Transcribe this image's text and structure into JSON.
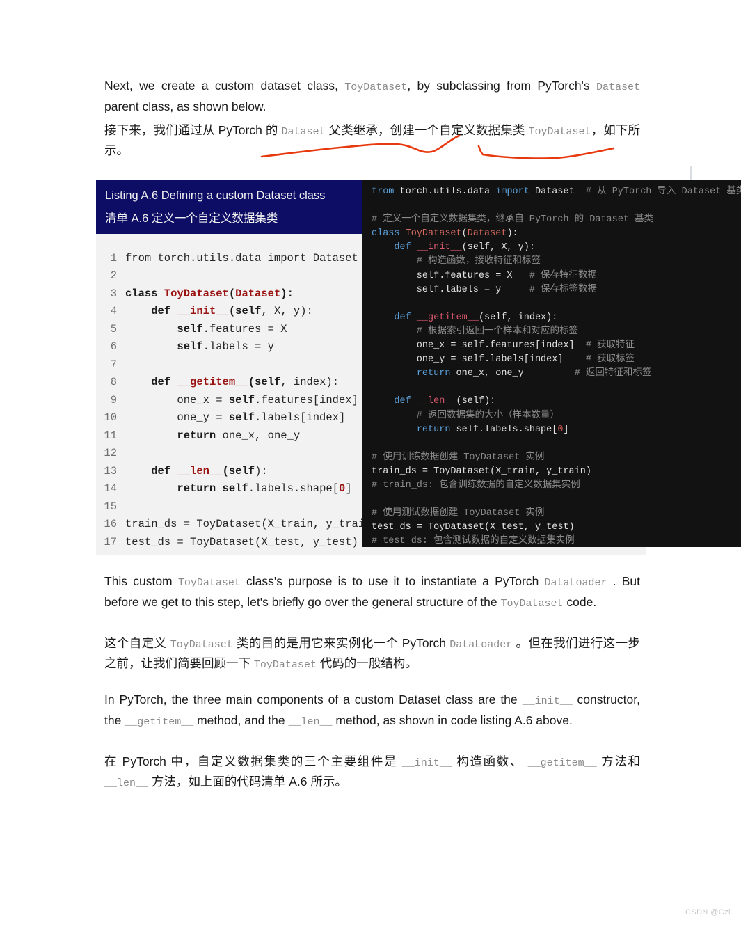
{
  "document": {
    "watermark": "CSDN @Czi."
  },
  "paragraphs": {
    "intro_en_1": "Next, we create a custom dataset class,",
    "intro_en_code1": "ToyDataset",
    "intro_en_2": ", by subclassing from PyTorch's",
    "intro_en_code2": "Dataset",
    "intro_en_3": "parent class, as shown below.",
    "intro_zh_1": "接下来，我们通过从 PyTorch 的",
    "intro_zh_code1": "Dataset",
    "intro_zh_2": "父类继承，创建一个自定义数据集类",
    "intro_zh_code2": "ToyDataset",
    "intro_zh_3": "，如下所示。",
    "mid_en_1": "This custom",
    "mid_en_code1": "ToyDataset",
    "mid_en_2": "class's purpose is to use it to instantiate a PyTorch",
    "mid_en_code2": "DataLoader",
    "mid_en_3": ". But before we get to this step, let's briefly go over the general structure of the",
    "mid_en_code3": "ToyDataset",
    "mid_en_4": "code.",
    "mid_zh_1": "这个自定义",
    "mid_zh_code1": "ToyDataset",
    "mid_zh_2": "类的目的是用它来实例化一个 PyTorch",
    "mid_zh_code2": "DataLoader",
    "mid_zh_3": "。但在我们进行这一步之前，让我们简要回顾一下",
    "mid_zh_code3": "ToyDataset",
    "mid_zh_4": "代码的一般结构。",
    "last_en_1": "In PyTorch, the three main components of a custom Dataset class are the",
    "last_en_code1": "__init__",
    "last_en_2": "constructor, the",
    "last_en_code2": "__getitem__",
    "last_en_3": "method, and the",
    "last_en_code3": "__len__",
    "last_en_4": "method, as shown in code listing A.6 above.",
    "last_zh_1": "在 PyTorch 中，自定义数据集类的三个主要组件是",
    "last_zh_code1": "__init__",
    "last_zh_2": "构造函数、",
    "last_zh_code2": "__getitem__",
    "last_zh_3": "方法和",
    "last_zh_code3": "__len__",
    "last_zh_4": "方法，如上面的代码清单 A.6 所示。"
  },
  "listing": {
    "caption_en": "Listing A.6 Defining a custom Dataset class",
    "caption_zh": "清单 A.6 定义一个自定义数据集类",
    "header_bg": "#0d0d66",
    "code_bg": "#f2f2f2",
    "lines": [
      {
        "n": "1",
        "parts": [
          {
            "t": "from torch.utils.data import Dataset",
            "c": "plain"
          }
        ]
      },
      {
        "n": "2",
        "parts": []
      },
      {
        "n": "3",
        "parts": [
          {
            "t": "class ",
            "c": "kw"
          },
          {
            "t": "ToyDataset",
            "c": "nm"
          },
          {
            "t": "(",
            "c": "kw"
          },
          {
            "t": "Dataset",
            "c": "nm"
          },
          {
            "t": "):",
            "c": "kw"
          }
        ]
      },
      {
        "n": "4",
        "parts": [
          {
            "t": "    ",
            "c": "plain"
          },
          {
            "t": "def ",
            "c": "kw"
          },
          {
            "t": "__init__",
            "c": "nm"
          },
          {
            "t": "(",
            "c": "kw"
          },
          {
            "t": "self",
            "c": "kw"
          },
          {
            "t": ", X, y):",
            "c": "plain"
          }
        ]
      },
      {
        "n": "5",
        "parts": [
          {
            "t": "        ",
            "c": "plain"
          },
          {
            "t": "self",
            "c": "kw"
          },
          {
            "t": ".features = X",
            "c": "plain"
          }
        ]
      },
      {
        "n": "6",
        "parts": [
          {
            "t": "        ",
            "c": "plain"
          },
          {
            "t": "self",
            "c": "kw"
          },
          {
            "t": ".labels = y",
            "c": "plain"
          }
        ]
      },
      {
        "n": "7",
        "parts": []
      },
      {
        "n": "8",
        "parts": [
          {
            "t": "    ",
            "c": "plain"
          },
          {
            "t": "def ",
            "c": "kw"
          },
          {
            "t": "__getitem__",
            "c": "nm"
          },
          {
            "t": "(",
            "c": "kw"
          },
          {
            "t": "self",
            "c": "kw"
          },
          {
            "t": ", index):",
            "c": "plain"
          }
        ]
      },
      {
        "n": "9",
        "parts": [
          {
            "t": "        one_x = ",
            "c": "plain"
          },
          {
            "t": "self",
            "c": "kw"
          },
          {
            "t": ".features[index]",
            "c": "plain"
          }
        ]
      },
      {
        "n": "10",
        "parts": [
          {
            "t": "        one_y = ",
            "c": "plain"
          },
          {
            "t": "self",
            "c": "kw"
          },
          {
            "t": ".labels[index]",
            "c": "plain"
          }
        ]
      },
      {
        "n": "11",
        "parts": [
          {
            "t": "        ",
            "c": "plain"
          },
          {
            "t": "return",
            "c": "kw"
          },
          {
            "t": " one_x, one_y",
            "c": "plain"
          }
        ]
      },
      {
        "n": "12",
        "parts": []
      },
      {
        "n": "13",
        "parts": [
          {
            "t": "    ",
            "c": "plain"
          },
          {
            "t": "def ",
            "c": "kw"
          },
          {
            "t": "__len__",
            "c": "nm"
          },
          {
            "t": "(",
            "c": "kw"
          },
          {
            "t": "self",
            "c": "kw"
          },
          {
            "t": "):",
            "c": "plain"
          }
        ]
      },
      {
        "n": "14",
        "parts": [
          {
            "t": "        ",
            "c": "plain"
          },
          {
            "t": "return ",
            "c": "kw"
          },
          {
            "t": "self",
            "c": "kw"
          },
          {
            "t": ".labels.shape[",
            "c": "plain"
          },
          {
            "t": "0",
            "c": "num"
          },
          {
            "t": "]",
            "c": "plain"
          }
        ]
      },
      {
        "n": "15",
        "parts": []
      },
      {
        "n": "16",
        "parts": [
          {
            "t": "train_ds = ToyDataset(X_train, y_train)",
            "c": "plain"
          }
        ]
      },
      {
        "n": "17",
        "parts": [
          {
            "t": "test_ds = ToyDataset(X_test, y_test)",
            "c": "plain"
          }
        ]
      }
    ]
  },
  "annotated_code": {
    "bg": "#121212",
    "lines": [
      [
        {
          "t": "from ",
          "c": "d-kw"
        },
        {
          "t": "torch.utils.data ",
          "c": "d-txt"
        },
        {
          "t": "import ",
          "c": "d-kw"
        },
        {
          "t": "Dataset",
          "c": "d-txt"
        },
        {
          "t": "  # 从 PyTorch 导入 Dataset 基类",
          "c": "d-cmt"
        }
      ],
      [],
      [
        {
          "t": "# 定义一个自定义数据集类，继承自 PyTorch 的 Dataset 基类",
          "c": "d-cmt"
        }
      ],
      [
        {
          "t": "class ",
          "c": "d-kw"
        },
        {
          "t": "ToyDataset",
          "c": "d-cls"
        },
        {
          "t": "(",
          "c": "d-txt"
        },
        {
          "t": "Dataset",
          "c": "d-cls"
        },
        {
          "t": "):",
          "c": "d-txt"
        }
      ],
      [
        {
          "t": "    ",
          "c": "d-txt"
        },
        {
          "t": "def ",
          "c": "d-kw"
        },
        {
          "t": "__init__",
          "c": "d-dun"
        },
        {
          "t": "(self, X, y):",
          "c": "d-txt"
        }
      ],
      [
        {
          "t": "        # 构造函数，接收特征和标签",
          "c": "d-cmt"
        }
      ],
      [
        {
          "t": "        self.features = X",
          "c": "d-txt"
        },
        {
          "t": "   # 保存特征数据",
          "c": "d-cmt"
        }
      ],
      [
        {
          "t": "        self.labels = y",
          "c": "d-txt"
        },
        {
          "t": "     # 保存标签数据",
          "c": "d-cmt"
        }
      ],
      [],
      [
        {
          "t": "    ",
          "c": "d-txt"
        },
        {
          "t": "def ",
          "c": "d-kw"
        },
        {
          "t": "__getitem__",
          "c": "d-dun"
        },
        {
          "t": "(self, index):",
          "c": "d-txt"
        }
      ],
      [
        {
          "t": "        # 根据索引返回一个样本和对应的标签",
          "c": "d-cmt"
        }
      ],
      [
        {
          "t": "        one_x = self.features[index]",
          "c": "d-txt"
        },
        {
          "t": "  # 获取特征",
          "c": "d-cmt"
        }
      ],
      [
        {
          "t": "        one_y = self.labels[index]",
          "c": "d-txt"
        },
        {
          "t": "    # 获取标签",
          "c": "d-cmt"
        }
      ],
      [
        {
          "t": "        ",
          "c": "d-txt"
        },
        {
          "t": "return ",
          "c": "d-kw"
        },
        {
          "t": "one_x, one_y",
          "c": "d-txt"
        },
        {
          "t": "         # 返回特征和标签",
          "c": "d-cmt"
        }
      ],
      [],
      [
        {
          "t": "    ",
          "c": "d-txt"
        },
        {
          "t": "def ",
          "c": "d-kw"
        },
        {
          "t": "__len__",
          "c": "d-dun"
        },
        {
          "t": "(self):",
          "c": "d-txt"
        }
      ],
      [
        {
          "t": "        # 返回数据集的大小（样本数量）",
          "c": "d-cmt"
        }
      ],
      [
        {
          "t": "        ",
          "c": "d-txt"
        },
        {
          "t": "return ",
          "c": "d-kw"
        },
        {
          "t": "self.labels.shape[",
          "c": "d-txt"
        },
        {
          "t": "0",
          "c": "d-num"
        },
        {
          "t": "]",
          "c": "d-txt"
        }
      ],
      [],
      [
        {
          "t": "# 使用训练数据创建 ToyDataset 实例",
          "c": "d-cmt"
        }
      ],
      [
        {
          "t": "train_ds = ToyDataset(X_train, y_train)",
          "c": "d-txt"
        }
      ],
      [
        {
          "t": "# train_ds: 包含训练数据的自定义数据集实例",
          "c": "d-cmt"
        }
      ],
      [],
      [
        {
          "t": "# 使用测试数据创建 ToyDataset 实例",
          "c": "d-cmt"
        }
      ],
      [
        {
          "t": "test_ds = ToyDataset(X_test, y_test)",
          "c": "d-txt"
        }
      ],
      [
        {
          "t": "# test_ds: 包含测试数据的自定义数据集实例",
          "c": "d-cmt"
        }
      ]
    ]
  },
  "annotations": {
    "ink_color": "#e8380d",
    "marks": [
      "underline-squiggle-1",
      "underline-squiggle-2"
    ]
  }
}
